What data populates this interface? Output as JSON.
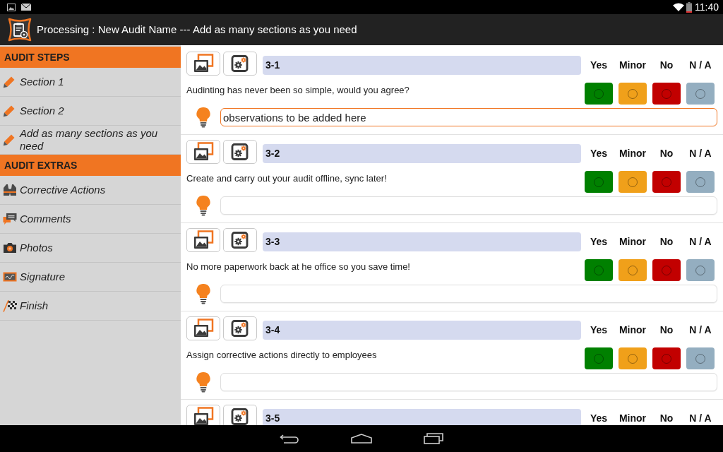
{
  "status_bar": {
    "time": "11:40"
  },
  "action_bar": {
    "title": "Processing : New Audit Name --- Add as many sections as you need"
  },
  "sidebar": {
    "groups": [
      {
        "header": "AUDIT STEPS",
        "items": [
          {
            "kind": "section",
            "label": "Section 1"
          },
          {
            "kind": "section",
            "label": "Section 2"
          },
          {
            "kind": "section",
            "label": "Add as many sections as you need"
          }
        ]
      },
      {
        "header": "AUDIT EXTRAS",
        "items": [
          {
            "kind": "corrective_actions",
            "label": "Corrective Actions"
          },
          {
            "kind": "comments",
            "label": "Comments"
          },
          {
            "kind": "photos",
            "label": "Photos"
          },
          {
            "kind": "signature",
            "label": "Signature"
          },
          {
            "kind": "finish",
            "label": "Finish"
          }
        ]
      }
    ]
  },
  "questions": [
    {
      "number": "3-1",
      "text": "Audinting has never been so simple, would you agree?",
      "options": [
        {
          "label": "Yes",
          "color": "#008000",
          "selected": false
        },
        {
          "label": "Minor",
          "color": "#f0a01a",
          "selected": false
        },
        {
          "label": "No",
          "color": "#c20000",
          "selected": false
        },
        {
          "label": "N / A",
          "color": "#94aec0",
          "selected": false
        }
      ],
      "observation": {
        "value": "observations to be added here",
        "focused": true
      }
    },
    {
      "number": "3-2",
      "text": "Create and carry out your audit offline, sync later!",
      "options": [
        {
          "label": "Yes",
          "color": "#008000",
          "selected": false
        },
        {
          "label": "Minor",
          "color": "#f0a01a",
          "selected": false
        },
        {
          "label": "No",
          "color": "#c20000",
          "selected": false
        },
        {
          "label": "N / A",
          "color": "#94aec0",
          "selected": false
        }
      ],
      "observation": {
        "focused": false
      }
    },
    {
      "number": "3-3",
      "text": "No more paperwork back at he office so you save time!",
      "options": [
        {
          "label": "Yes",
          "color": "#008000",
          "selected": false
        },
        {
          "label": "Minor",
          "color": "#f0a01a",
          "selected": false
        },
        {
          "label": "No",
          "color": "#c20000",
          "selected": false
        },
        {
          "label": "N / A",
          "color": "#94aec0",
          "selected": false
        }
      ],
      "observation": {
        "focused": false
      }
    },
    {
      "number": "3-4",
      "text": "Assign corrective actions directly to employees",
      "options": [
        {
          "label": "Yes",
          "color": "#008000",
          "selected": false
        },
        {
          "label": "Minor",
          "color": "#f0a01a",
          "selected": false
        },
        {
          "label": "No",
          "color": "#c20000",
          "selected": false
        },
        {
          "label": "N / A",
          "color": "#94aec0",
          "selected": false
        }
      ],
      "observation": {
        "focused": false
      }
    },
    {
      "number": "3-5",
      "options": [
        {
          "label": "Yes"
        },
        {
          "label": "Minor"
        },
        {
          "label": "No"
        },
        {
          "label": "N / A"
        }
      ]
    }
  ]
}
